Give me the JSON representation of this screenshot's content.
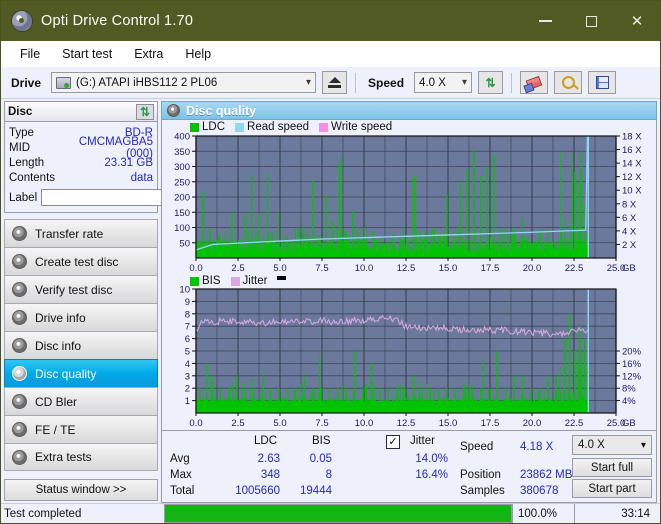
{
  "window": {
    "title": "Opti Drive Control 1.70",
    "icon": "disc-icon",
    "minimize": "minimize-icon",
    "maximize": "maximize-icon",
    "close": "close-icon",
    "titlebar_color": "#515a22"
  },
  "menu": {
    "items": [
      "File",
      "Start test",
      "Extra",
      "Help"
    ]
  },
  "toolbar": {
    "drive_label": "Drive",
    "drive_value": "(G:)  ATAPI iHBS112  2 PL06",
    "eject_icon": "eject-icon",
    "speed_label": "Speed",
    "speed_value": "4.0 X",
    "refresh_icon": "refresh-icon",
    "erase_icon": "eraser-icon",
    "inspect_icon": "magnifier-icon",
    "save_icon": "save-icon"
  },
  "disc_panel": {
    "title": "Disc",
    "refresh_icon": "refresh-icon",
    "rows": [
      {
        "key": "Type",
        "value": "BD-R"
      },
      {
        "key": "MID",
        "value": "CMCMAGBA5 (000)"
      },
      {
        "key": "Length",
        "value": "23.31 GB"
      },
      {
        "key": "Contents",
        "value": "data"
      }
    ],
    "label_key": "Label",
    "label_value": "",
    "label_placeholder": "",
    "label_button_icon": "disc-icon"
  },
  "sidebar": {
    "items": [
      {
        "label": "Transfer rate",
        "icon": "disc-icon",
        "active": false
      },
      {
        "label": "Create test disc",
        "icon": "disc-icon",
        "active": false
      },
      {
        "label": "Verify test disc",
        "icon": "disc-icon",
        "active": false
      },
      {
        "label": "Drive info",
        "icon": "disc-icon",
        "active": false
      },
      {
        "label": "Disc info",
        "icon": "disc-icon",
        "active": false
      },
      {
        "label": "Disc quality",
        "icon": "disc-icon",
        "active": true
      },
      {
        "label": "CD Bler",
        "icon": "disc-icon",
        "active": false
      },
      {
        "label": "FE / TE",
        "icon": "disc-icon",
        "active": false
      },
      {
        "label": "Extra tests",
        "icon": "disc-icon",
        "active": false
      }
    ],
    "status_window_button": "Status window >>"
  },
  "main": {
    "panel_title": "Disc quality",
    "panel_icon": "disc-icon"
  },
  "stats": {
    "columns": [
      "LDC",
      "BIS"
    ],
    "jitter_label": "Jitter",
    "jitter_checked": true,
    "rows": [
      {
        "label": "Avg",
        "ldc": "2.63",
        "bis": "0.05",
        "jitter": "14.0%"
      },
      {
        "label": "Max",
        "ldc": "348",
        "bis": "8",
        "jitter": "16.4%"
      },
      {
        "label": "Total",
        "ldc": "1005660",
        "bis": "19444",
        "jitter": ""
      }
    ],
    "speed_label": "Speed",
    "speed_value": "4.18 X",
    "position_label": "Position",
    "position_value": "23862 MB",
    "samples_label": "Samples",
    "samples_value": "380678",
    "speed_select": "4.0 X",
    "start_full_button": "Start full",
    "start_part_button": "Start part"
  },
  "statusbar": {
    "message": "Test completed",
    "percent": "100.0%",
    "progress_value": 100,
    "elapsed": "33:14",
    "progress_color": "#12b512"
  },
  "chart_data": [
    {
      "type": "line",
      "id": "ldc-chart",
      "title": "",
      "xlabel": "GB",
      "ylabel": "",
      "xlim": [
        0,
        25.0
      ],
      "xticks": [
        "0.0",
        "2.5",
        "5.0",
        "7.5",
        "10.0",
        "12.5",
        "15.0",
        "17.5",
        "20.0",
        "22.5",
        "25.0"
      ],
      "ylim": [
        0,
        400
      ],
      "yticks": [
        "50",
        "100",
        "150",
        "200",
        "250",
        "300",
        "350",
        "400"
      ],
      "y2lim": [
        0,
        18
      ],
      "y2ticks": [
        "2 X",
        "4 X",
        "6 X",
        "8 X",
        "10 X",
        "12 X",
        "14 X",
        "16 X",
        "18 X"
      ],
      "y2label": "X",
      "grid": true,
      "legend": [
        {
          "name": "LDC",
          "color": "#00c400"
        },
        {
          "name": "Read speed",
          "color": "#8fd8f5"
        },
        {
          "name": "Write speed",
          "color": "#f58fe0"
        }
      ],
      "plot_bg": "#6b7a9c",
      "series": [
        {
          "name": "LDC",
          "type": "bar",
          "color": "#00c400",
          "note": "dense noisy error spikes, baseline ~20-60, spikes up to 348 near 22.5 GB",
          "x": [
            0.1,
            0.4,
            0.8,
            1.0,
            1.3,
            1.7,
            2.1,
            2.5,
            2.9,
            3.3,
            3.7,
            4.1,
            4.5,
            4.9,
            5.3,
            5.7,
            6.1,
            6.5,
            6.9,
            7.3,
            7.7,
            8.1,
            8.5,
            8.9,
            9.3,
            9.7,
            10.1,
            10.5,
            10.9,
            11.3,
            11.7,
            12.1,
            12.5,
            12.9,
            13.3,
            13.7,
            14.1,
            14.5,
            14.9,
            15.3,
            15.7,
            16.1,
            16.5,
            16.9,
            17.3,
            17.7,
            18.1,
            18.5,
            18.9,
            19.3,
            19.7,
            20.1,
            20.5,
            20.9,
            21.3,
            21.7,
            22.1,
            22.5,
            22.9,
            23.2
          ],
          "values": [
            40,
            215,
            95,
            60,
            70,
            55,
            150,
            60,
            140,
            70,
            145,
            60,
            85,
            55,
            75,
            60,
            100,
            65,
            255,
            75,
            205,
            120,
            70,
            80,
            155,
            65,
            75,
            90,
            70,
            60,
            80,
            70,
            75,
            265,
            85,
            70,
            95,
            80,
            210,
            90,
            250,
            290,
            350,
            270,
            300,
            340,
            95,
            80,
            70,
            60,
            65,
            55,
            60,
            50,
            55,
            60,
            65,
            70,
            60,
            55
          ]
        },
        {
          "name": "Read speed",
          "type": "line",
          "color": "#8fd8f5",
          "x": [
            0.0,
            1.0,
            2.5,
            5.0,
            7.5,
            10.0,
            12.5,
            15.0,
            17.5,
            20.0,
            22.0,
            23.2,
            23.3
          ],
          "values": [
            1.2,
            2.0,
            2.2,
            2.5,
            2.8,
            3.0,
            3.2,
            3.4,
            3.6,
            3.8,
            4.0,
            4.1,
            18.0
          ]
        },
        {
          "name": "Write speed",
          "type": "line",
          "color": "#f58fe0",
          "x": [],
          "values": []
        }
      ]
    },
    {
      "type": "line",
      "id": "bis-jitter-chart",
      "title": "",
      "xlabel": "GB",
      "ylabel": "",
      "xlim": [
        0,
        25.0
      ],
      "xticks": [
        "0.0",
        "2.5",
        "5.0",
        "7.5",
        "10.0",
        "12.5",
        "15.0",
        "17.5",
        "20.0",
        "22.5",
        "25.0"
      ],
      "ylim": [
        0,
        10
      ],
      "yticks": [
        "1",
        "2",
        "3",
        "4",
        "5",
        "6",
        "7",
        "8",
        "9",
        "10"
      ],
      "y2lim": [
        0,
        20
      ],
      "y2ticks": [
        "4%",
        "8%",
        "12%",
        "16%",
        "20%"
      ],
      "grid": true,
      "legend": [
        {
          "name": "BIS",
          "color": "#00c400"
        },
        {
          "name": "Jitter",
          "color": "#d9a8e0"
        }
      ],
      "plot_bg": "#6b7a9c",
      "series": [
        {
          "name": "BIS",
          "type": "bar",
          "color": "#00c400",
          "note": "dense baseline ~1, scattered spikes 2-5, cluster up to 8 near 22-23 GB",
          "x": [
            0.2,
            0.6,
            0.9,
            1.4,
            1.9,
            2.4,
            2.9,
            3.4,
            3.9,
            4.4,
            4.9,
            5.4,
            5.9,
            6.4,
            6.9,
            7.4,
            7.9,
            8.4,
            8.9,
            9.4,
            9.9,
            10.4,
            10.9,
            11.4,
            11.9,
            12.4,
            12.9,
            13.4,
            13.9,
            14.4,
            14.9,
            15.4,
            15.9,
            16.4,
            16.9,
            17.4,
            17.9,
            18.4,
            18.9,
            19.4,
            19.9,
            20.4,
            20.9,
            21.4,
            21.9,
            22.2,
            22.5,
            22.8,
            23.1
          ],
          "values": [
            2,
            4,
            3,
            2,
            2,
            3,
            2,
            2,
            2,
            2,
            2,
            2,
            2,
            3,
            2,
            2,
            2,
            2,
            2,
            5,
            2,
            4,
            2,
            2,
            2,
            2,
            3,
            2,
            2,
            2,
            2,
            2,
            2,
            2,
            2,
            2,
            5,
            2,
            3,
            3,
            2,
            2,
            3,
            3,
            6,
            8,
            5,
            7,
            6
          ]
        },
        {
          "name": "Jitter",
          "type": "line",
          "color": "#d9a8e0",
          "x": [
            0.0,
            0.5,
            1.0,
            2.0,
            3.0,
            4.0,
            5.0,
            6.0,
            7.0,
            8.0,
            9.0,
            10.0,
            11.0,
            12.0,
            12.5,
            13.0,
            14.0,
            15.0,
            16.0,
            17.0,
            18.0,
            19.0,
            20.0,
            21.0,
            22.0,
            22.5,
            23.0,
            23.3
          ],
          "values": [
            6.6,
            7.6,
            7.4,
            7.4,
            7.3,
            7.3,
            7.3,
            7.4,
            7.4,
            7.4,
            7.4,
            7.5,
            7.6,
            7.5,
            7.0,
            6.9,
            6.9,
            6.8,
            6.7,
            6.7,
            6.7,
            6.6,
            6.5,
            6.4,
            6.4,
            6.6,
            6.8,
            6.6
          ]
        }
      ]
    }
  ]
}
